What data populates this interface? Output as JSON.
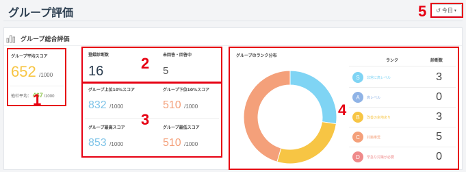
{
  "header": {
    "title": "グループ評価",
    "date_button_label": "今日"
  },
  "card": {
    "title": "グループ総合評価"
  },
  "annotations": [
    "1",
    "2",
    "3",
    "4",
    "5"
  ],
  "avg_score": {
    "label": "グループ平均スコア",
    "value": "652",
    "max": "/1000",
    "other_label": "他社平均：",
    "other_value": "467",
    "other_max": "/1000"
  },
  "counts": {
    "registered_label": "登録診断数",
    "registered_value": "16",
    "unanswered_label": "未回答・回答中",
    "unanswered_value": "5"
  },
  "scores": {
    "top10_label": "グループ上位10%スコア",
    "top10_value": "832",
    "top10_max": "/1000",
    "bottom10_label": "グループ下位10%スコア",
    "bottom10_value": "510",
    "bottom10_max": "/1000",
    "highest_label": "グループ最高スコア",
    "highest_value": "853",
    "highest_max": "/1000",
    "lowest_label": "グループ最低スコア",
    "lowest_value": "510",
    "lowest_max": "/1000"
  },
  "rank": {
    "chart_title": "グループのランク分布",
    "col_rank": "ランク",
    "col_count": "診断数",
    "rows": [
      {
        "letter": "S",
        "text": "非常に高レベル",
        "count": "3",
        "color": "#7fd4f4"
      },
      {
        "letter": "A",
        "text": "高レベル",
        "count": "0",
        "color": "#8fb3e6"
      },
      {
        "letter": "B",
        "text": "改善の余地あり",
        "count": "3",
        "color": "#f7c544"
      },
      {
        "letter": "C",
        "text": "対策推奨",
        "count": "5",
        "color": "#f4a07a"
      },
      {
        "letter": "D",
        "text": "早急な対策が必要",
        "count": "0",
        "color": "#ef8a8a"
      }
    ]
  },
  "colors": {
    "avg_value": "#f7c544",
    "other_value": "#8bc34a",
    "top_value": "#7fc4e8",
    "bottom_value": "#f4a07a",
    "annotation": "#e60012"
  },
  "chart_data": {
    "type": "pie",
    "title": "グループのランク分布",
    "categories": [
      "S",
      "A",
      "B",
      "C",
      "D"
    ],
    "values": [
      3,
      0,
      3,
      5,
      0
    ],
    "colors": [
      "#7fd4f4",
      "#8fb3e6",
      "#f7c544",
      "#f4a07a",
      "#ef8a8a"
    ],
    "donut": true
  }
}
